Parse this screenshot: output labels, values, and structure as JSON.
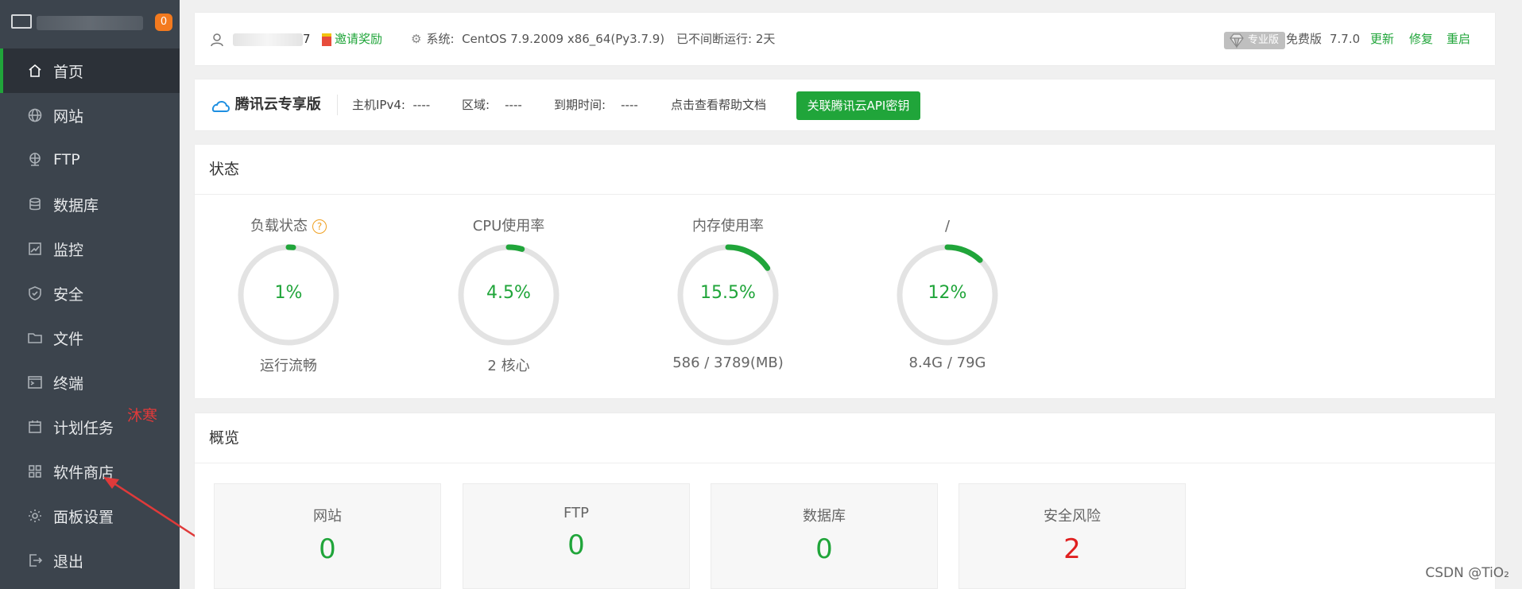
{
  "sidebar": {
    "message_count": "0",
    "items": [
      {
        "label": "首页",
        "icon": "home-icon",
        "active": true
      },
      {
        "label": "网站",
        "icon": "globe-icon"
      },
      {
        "label": "FTP",
        "icon": "ftp-icon"
      },
      {
        "label": "数据库",
        "icon": "database-icon"
      },
      {
        "label": "监控",
        "icon": "monitor-chart-icon"
      },
      {
        "label": "安全",
        "icon": "shield-icon"
      },
      {
        "label": "文件",
        "icon": "folder-icon"
      },
      {
        "label": "终端",
        "icon": "terminal-icon"
      },
      {
        "label": "计划任务",
        "icon": "calendar-icon"
      },
      {
        "label": "软件商店",
        "icon": "apps-grid-icon"
      },
      {
        "label": "面板设置",
        "icon": "gear-icon"
      },
      {
        "label": "退出",
        "icon": "logout-icon"
      }
    ],
    "annotation": "沐寒"
  },
  "topbar": {
    "user_suffix": "7",
    "invite": "邀请奖励",
    "system_label": "系统:",
    "system_value": "CentOS 7.9.2009 x86_64(Py3.7.9)",
    "uptime": "已不间断运行: 2天",
    "pro_badge": "专业版",
    "edition": "免费版",
    "version": "7.7.0",
    "update": "更新",
    "repair": "修复",
    "restart": "重启"
  },
  "tencent": {
    "title": "腾讯云专享版",
    "ipv4_label": "主机IPv4:",
    "ipv4_value": "----",
    "region_label": "区域:",
    "region_value": "----",
    "expire_label": "到期时间:",
    "expire_value": "----",
    "help_link": "点击查看帮助文档",
    "bind_button": "关联腾讯云API密钥"
  },
  "status": {
    "title": "状态",
    "gauges": [
      {
        "title": "负载状态",
        "value": "1%",
        "percent": 1,
        "sub": "运行流畅",
        "help": "?"
      },
      {
        "title": "CPU使用率",
        "value": "4.5%",
        "percent": 4.5,
        "sub": "2 核心"
      },
      {
        "title": "内存使用率",
        "value": "15.5%",
        "percent": 15.5,
        "sub": "586 / 3789(MB)"
      },
      {
        "title": "/",
        "value": "12%",
        "percent": 12,
        "sub": "8.4G / 79G"
      }
    ]
  },
  "overview": {
    "title": "概览",
    "boxes": [
      {
        "label": "网站",
        "value": "0"
      },
      {
        "label": "FTP",
        "value": "0"
      },
      {
        "label": "数据库",
        "value": "0"
      },
      {
        "label": "安全风险",
        "value": "2",
        "alert": true
      }
    ]
  },
  "watermark": "CSDN @TiO₂",
  "colors": {
    "accent": "#20a53a",
    "sidebar": "#3c444d",
    "alert": "#e02020"
  }
}
